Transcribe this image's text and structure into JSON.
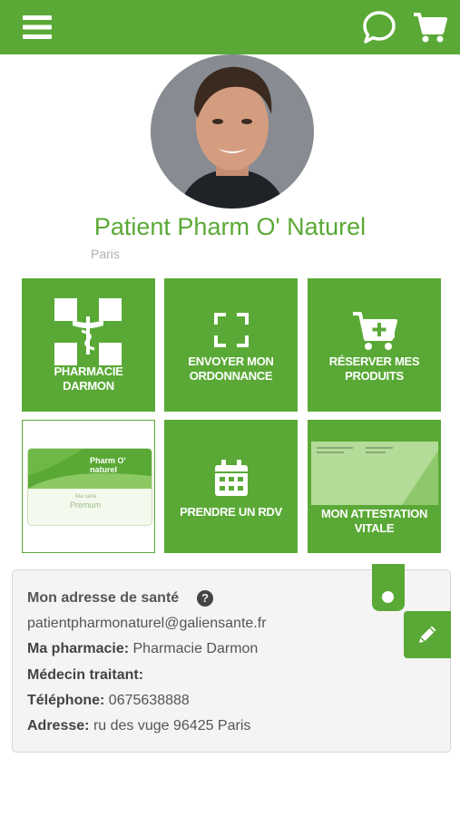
{
  "header": {
    "menu_icon": "hamburger-menu-icon",
    "chat_icon": "chat-bubble-icon",
    "cart_icon": "shopping-cart-icon",
    "color": "#5aa936"
  },
  "profile": {
    "name": "Patient Pharm O' Naturel",
    "city": "Paris"
  },
  "tiles": [
    {
      "label_line1": "PHARMACIE",
      "label_line2": "DARMON",
      "icon": "pharmacy-cross-icon"
    },
    {
      "label_line1": "ENVOYER MON",
      "label_line2": "ORDONNANCE",
      "icon": "scan-frame-icon"
    },
    {
      "label_line1": "RÉSERVER MES",
      "label_line2": "PRODUITS",
      "icon": "cart-plus-icon"
    },
    {
      "card_brand_line1": "Pharm O'",
      "card_brand_line2": "naturel",
      "card_caption": "Ma carte",
      "card_tier": "Premum",
      "icon": "loyalty-card-image"
    },
    {
      "label": "PRENDRE UN RDV",
      "icon": "calendar-icon"
    },
    {
      "label_line1": "MON ATTESTATION",
      "label_line2": "VITALE",
      "icon": "attestation-document-image"
    }
  ],
  "info": {
    "title": "Mon adresse de santé",
    "help_glyph": "?",
    "email": "patientpharmonaturel@galiensante.fr",
    "pharmacy_label": "Ma pharmacie:",
    "pharmacy_value": "Pharmacie Darmon",
    "doctor_label": "Médecin traitant:",
    "phone_label": "Téléphone:",
    "phone_value": "0675638888",
    "address_label": "Adresse:",
    "address_value": "ru des vuge 96425 Paris"
  }
}
